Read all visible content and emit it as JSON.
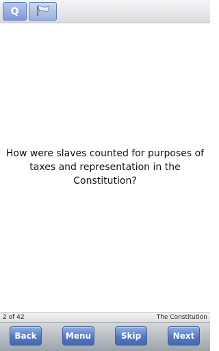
{
  "toolbar": {
    "question_tab_label": "Q",
    "flag_icon": "flag-icon"
  },
  "question": {
    "lines": [
      "How were slaves counted for purposes of",
      "taxes and representation in the",
      "Constitution?"
    ]
  },
  "status": {
    "progress": "2 of 42",
    "category": "The Constitution"
  },
  "nav": {
    "back_label": "Back",
    "menu_label": "Menu",
    "skip_label": "Skip",
    "next_label": "Next"
  },
  "colors": {
    "accent": "#5579c0",
    "tab_active": "#7f97d8"
  }
}
